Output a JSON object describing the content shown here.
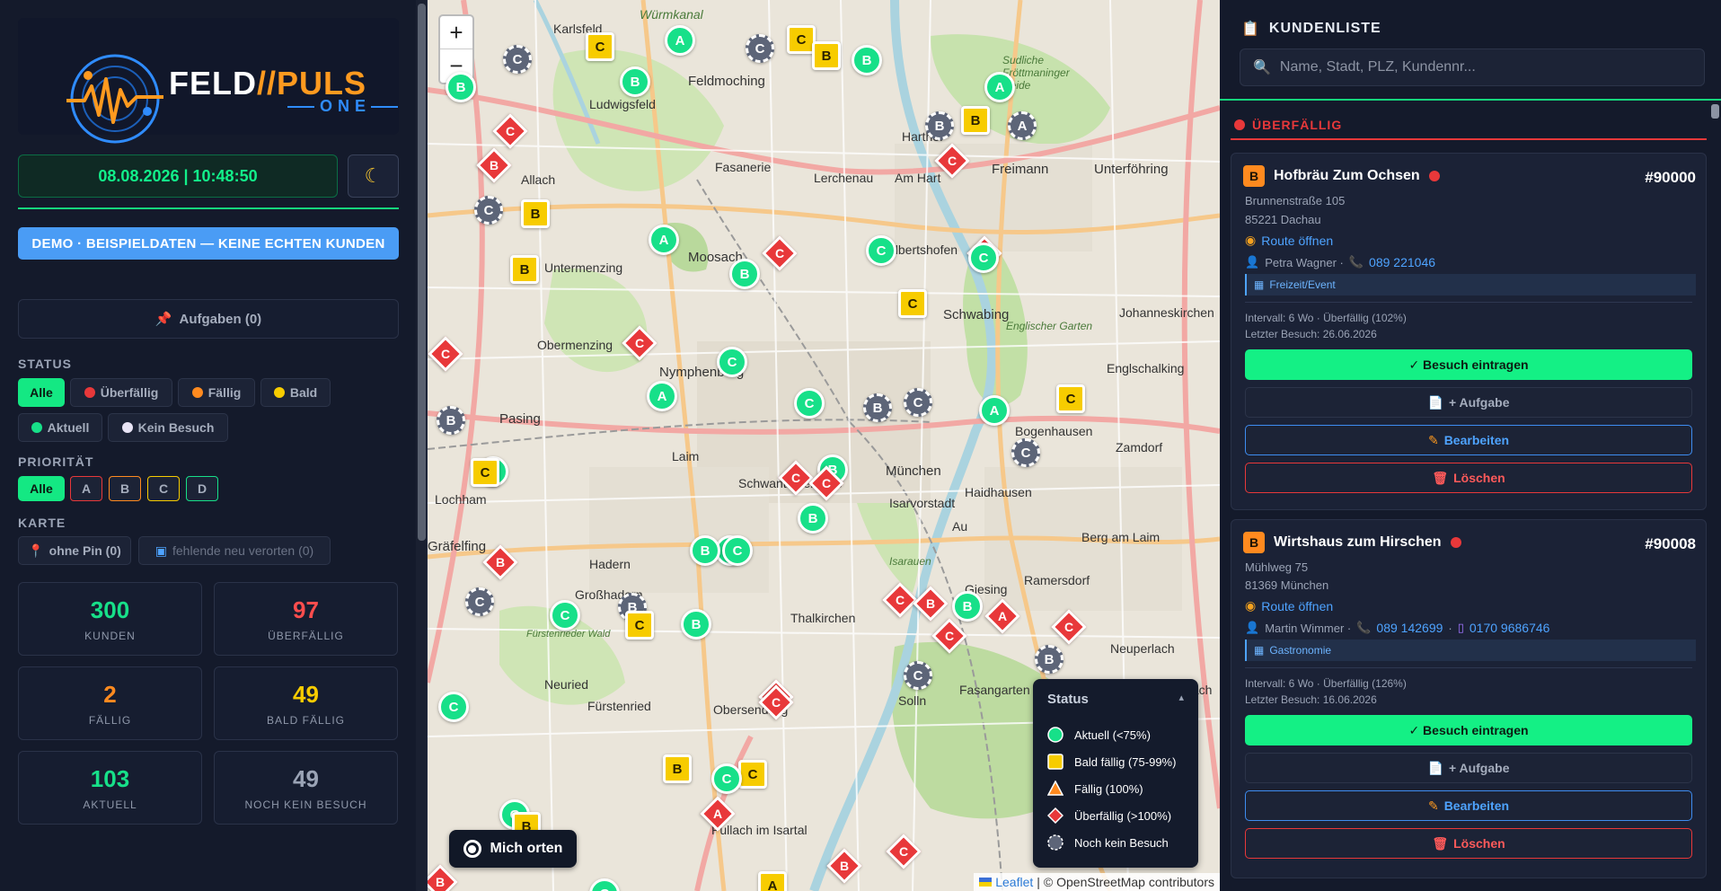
{
  "brand": {
    "feld": "FELD",
    "slash": "//",
    "puls": "PULS",
    "one": "ONE"
  },
  "datetime": "08.08.2026 | 10:48:50",
  "theme_icon": "moon-icon",
  "demo_banner": "DEMO · BEISPIELDATEN — KEINE ECHTEN KUNDEN",
  "tasks_button": "Aufgaben (0)",
  "status": {
    "label": "STATUS",
    "chips": [
      {
        "label": "Alle",
        "active": true
      },
      {
        "label": "Überfällig",
        "color": "#e8383a"
      },
      {
        "label": "Fällig",
        "color": "#ff8a1f"
      },
      {
        "label": "Bald",
        "color": "#f7cc00"
      },
      {
        "label": "Aktuell",
        "color": "#17e089"
      },
      {
        "label": "Kein Besuch",
        "color": "#e8e4f5"
      }
    ]
  },
  "priority": {
    "label": "PRIORITÄT",
    "chips": [
      {
        "label": "Alle",
        "active": true
      },
      {
        "label": "A",
        "color": "#e8383a"
      },
      {
        "label": "B",
        "color": "#ff8a1f"
      },
      {
        "label": "C",
        "color": "#f7cc00"
      },
      {
        "label": "D",
        "color": "#17e089"
      }
    ]
  },
  "karte": {
    "label": "KARTE",
    "no_pin": "ohne Pin (0)",
    "relocate": "fehlende neu verorten (0)"
  },
  "stats": [
    {
      "value": "300",
      "label": "KUNDEN",
      "color": "#17e089"
    },
    {
      "value": "97",
      "label": "ÜBERFÄLLIG",
      "color": "#ff4d4d"
    },
    {
      "value": "2",
      "label": "FÄLLIG",
      "color": "#ff8a1f"
    },
    {
      "value": "49",
      "label": "BALD FÄLLIG",
      "color": "#f7cc00"
    },
    {
      "value": "103",
      "label": "AKTUELL",
      "color": "#17e089"
    },
    {
      "value": "49",
      "label": "NOCH KEIN BESUCH",
      "color": "#9aa3b5"
    }
  ],
  "map": {
    "zoom_in": "+",
    "zoom_out": "−",
    "locate_button": "Mich orten",
    "labels": [
      "Karlsfeld",
      "Würmkanal",
      "Feldmoching",
      "Ludwigsfeld",
      "Fasanerie",
      "Lerchenau",
      "Am Hart",
      "Harthof",
      "Freimann",
      "Unterföhring",
      "Allach",
      "Moosach",
      "Milbertshofen",
      "Obermenzing",
      "Schwabing",
      "Englischer Garten",
      "Johanneskirchen",
      "Nymphenburg",
      "Englschalking",
      "Pasing",
      "Laim",
      "Bogenhausen",
      "Zamdorf",
      "Schwanthalerhöhe",
      "Haidhausen",
      "München",
      "Isarvorstadt",
      "Au",
      "Lochham",
      "Gräfelfing",
      "Großhadern",
      "Hadern",
      "Isarauen",
      "Berg am Laim",
      "Ramersdorf",
      "Neuperlach",
      "Fürstenrieder Wald",
      "Neuried",
      "Fürstenried",
      "Obersendling",
      "Thalkirchen",
      "Giesing",
      "Fasangarten",
      "Perlach",
      "Solln",
      "Pullach im Isartal",
      "Untermenzing",
      "Sudliche Fröttmaninger Heide"
    ],
    "markers": [
      {
        "t": "B",
        "s": "green"
      },
      {
        "t": "C",
        "s": "gray"
      },
      {
        "t": "C",
        "s": "yellow"
      },
      {
        "t": "A",
        "s": "green"
      },
      {
        "t": "C",
        "s": "gray"
      },
      {
        "t": "B",
        "s": "green"
      },
      {
        "t": "C",
        "s": "yellow"
      },
      {
        "t": "B",
        "s": "yellow"
      },
      {
        "t": "B",
        "s": "green"
      },
      {
        "t": "A",
        "s": "green"
      },
      {
        "t": "B",
        "s": "yellow"
      },
      {
        "t": "A",
        "s": "gray"
      },
      {
        "t": "B",
        "s": "gray"
      },
      {
        "t": "C",
        "s": "red"
      },
      {
        "t": "B",
        "s": "red"
      },
      {
        "t": "C",
        "s": "red"
      },
      {
        "t": "C",
        "s": "gray"
      },
      {
        "t": "B",
        "s": "yellow"
      },
      {
        "t": "A",
        "s": "green"
      },
      {
        "t": "C",
        "s": "red"
      },
      {
        "t": "C",
        "s": "green"
      },
      {
        "t": "C",
        "s": "red"
      },
      {
        "t": "C",
        "s": "green"
      },
      {
        "t": "B",
        "s": "yellow"
      },
      {
        "t": "B",
        "s": "green"
      },
      {
        "t": "C",
        "s": "yellow"
      },
      {
        "t": "C",
        "s": "red"
      },
      {
        "t": "C",
        "s": "red"
      },
      {
        "t": "C",
        "s": "red"
      },
      {
        "t": "C",
        "s": "green"
      },
      {
        "t": "A",
        "s": "green"
      },
      {
        "t": "C",
        "s": "green"
      },
      {
        "t": "B",
        "s": "gray"
      },
      {
        "t": "C",
        "s": "gray"
      },
      {
        "t": "A",
        "s": "green"
      },
      {
        "t": "C",
        "s": "yellow"
      },
      {
        "t": "B",
        "s": "gray"
      },
      {
        "t": "C",
        "s": "gray"
      },
      {
        "t": "C",
        "s": "green"
      },
      {
        "t": "B",
        "s": "green"
      },
      {
        "t": "C",
        "s": "red"
      },
      {
        "t": "C",
        "s": "yellow"
      },
      {
        "t": "B",
        "s": "green"
      },
      {
        "t": "C",
        "s": "green"
      },
      {
        "t": "B",
        "s": "green"
      },
      {
        "t": "C",
        "s": "green"
      },
      {
        "t": "B",
        "s": "red"
      },
      {
        "t": "C",
        "s": "gray"
      },
      {
        "t": "C",
        "s": "green"
      },
      {
        "t": "B",
        "s": "gray"
      },
      {
        "t": "C",
        "s": "yellow"
      },
      {
        "t": "B",
        "s": "green"
      },
      {
        "t": "C",
        "s": "red"
      },
      {
        "t": "B",
        "s": "red"
      },
      {
        "t": "B",
        "s": "green"
      },
      {
        "t": "C",
        "s": "red"
      },
      {
        "t": "A",
        "s": "red"
      },
      {
        "t": "C",
        "s": "red"
      },
      {
        "t": "B",
        "s": "gray"
      },
      {
        "t": "C",
        "s": "gray"
      },
      {
        "t": "B",
        "s": "red"
      },
      {
        "t": "C",
        "s": "green"
      },
      {
        "t": "C",
        "s": "red"
      },
      {
        "t": "B",
        "s": "yellow"
      },
      {
        "t": "C",
        "s": "yellow"
      },
      {
        "t": "C",
        "s": "green"
      },
      {
        "t": "A",
        "s": "red"
      },
      {
        "t": "C",
        "s": "green"
      },
      {
        "t": "B",
        "s": "yellow"
      },
      {
        "t": "C",
        "s": "red"
      },
      {
        "t": "B",
        "s": "red"
      },
      {
        "t": "A",
        "s": "yellow"
      },
      {
        "t": "B",
        "s": "red"
      },
      {
        "t": "C",
        "s": "green"
      }
    ],
    "legend": {
      "title": "Status",
      "collapse": "▴",
      "items": [
        {
          "label": "Aktuell (<75%)",
          "shape": "circle",
          "color": "#17e089"
        },
        {
          "label": "Bald fällig (75-99%)",
          "shape": "square",
          "color": "#f7cc00"
        },
        {
          "label": "Fällig (100%)",
          "shape": "triangle",
          "color": "#ff8a1f"
        },
        {
          "label": "Überfällig (>100%)",
          "shape": "diamond",
          "color": "#e8383a"
        },
        {
          "label": "Noch kein Besuch",
          "shape": "gear",
          "color": "#5d6578"
        }
      ]
    },
    "attribution": {
      "leaflet": "Leaflet",
      "osm": "© OpenStreetMap contributors",
      "sep": "|"
    }
  },
  "panel": {
    "title": "KUNDENLISTE",
    "search_placeholder": "Name, Stadt, PLZ, Kundennr...",
    "group": "ÜBERFÄLLIG",
    "customers": [
      {
        "prio": "B",
        "name": "Hofbräu Zum Ochsen",
        "number": "#90000",
        "street": "Brunnenstraße 105",
        "city": "85221 Dachau",
        "route": "Route öffnen",
        "contact": "Petra Wagner ·",
        "phone": "089 221046",
        "mobile": "",
        "tag": "Freizeit/Event",
        "interval": "Intervall: 6 Wo · Überfällig (102%)",
        "last_visit": "Letzter Besuch: 26.06.2026",
        "btn_visit": "✓ Besuch eintragen",
        "btn_task": "+ Aufgabe",
        "btn_edit": "Bearbeiten",
        "btn_delete": "Löschen"
      },
      {
        "prio": "B",
        "name": "Wirtshaus zum Hirschen",
        "number": "#90008",
        "street": "Mühlweg 75",
        "city": "81369 München",
        "route": "Route öffnen",
        "contact": "Martin Wimmer ·",
        "phone": "089 142699",
        "sep": "·",
        "mobile": "0170 9686746",
        "tag": "Gastronomie",
        "interval": "Intervall: 6 Wo · Überfällig (126%)",
        "last_visit": "Letzter Besuch: 16.06.2026",
        "btn_visit": "✓ Besuch eintragen",
        "btn_task": "+ Aufgabe",
        "btn_edit": "Bearbeiten",
        "btn_delete": "Löschen"
      }
    ]
  }
}
